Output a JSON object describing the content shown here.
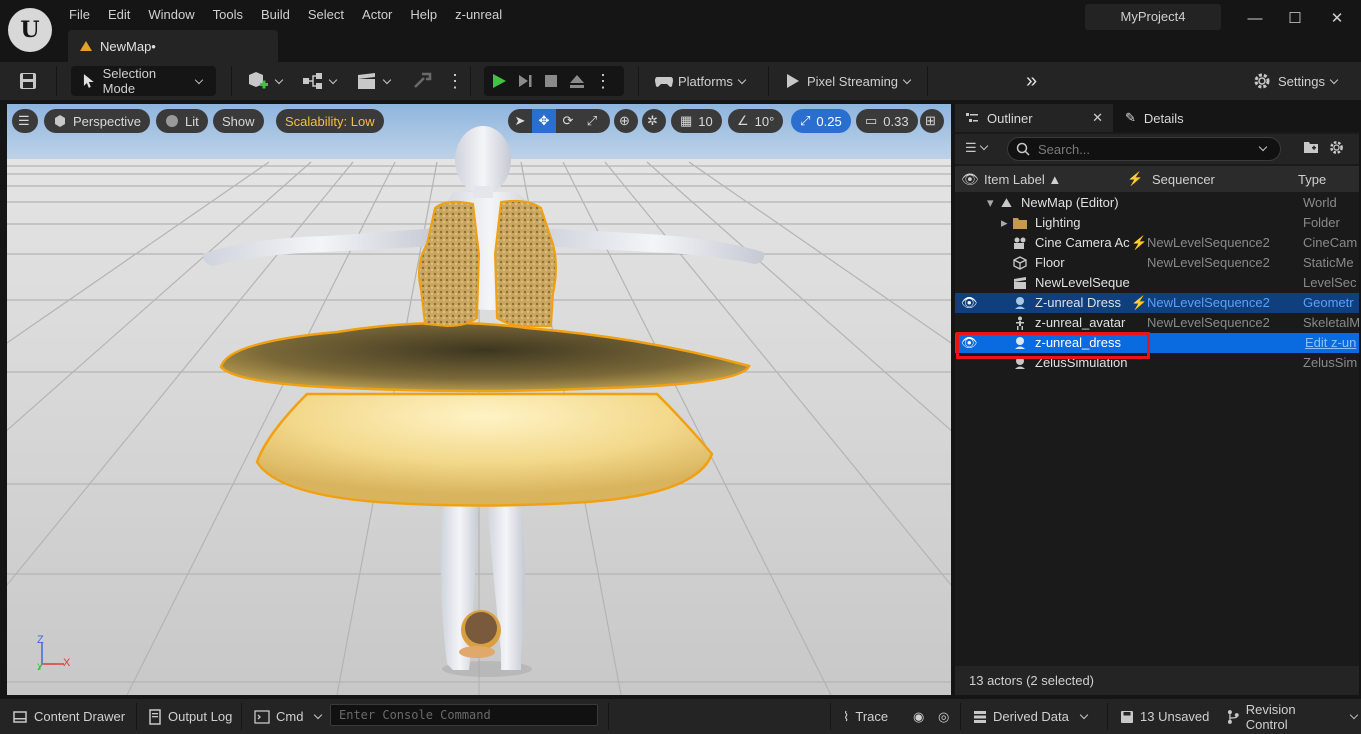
{
  "app": {
    "menu": [
      "File",
      "Edit",
      "Window",
      "Tools",
      "Build",
      "Select",
      "Actor",
      "Help",
      "z-unreal"
    ],
    "project_name": "MyProject4",
    "document_tab": "NewMap•"
  },
  "toolbar": {
    "mode_label": "Selection Mode",
    "platforms_label": "Platforms",
    "pixel_streaming_label": "Pixel Streaming",
    "settings_label": "Settings"
  },
  "viewport": {
    "perspective_label": "Perspective",
    "lit_label": "Lit",
    "show_label": "Show",
    "scalability_label": "Scalability: Low",
    "grid_snap": "10",
    "rotation_snap": "10°",
    "scale_snap": "0.25",
    "camera_speed": "0.33",
    "axis_z": "Z",
    "axis_x": "X",
    "axis_y": "Y"
  },
  "outliner": {
    "tab_outliner": "Outliner",
    "tab_details": "Details",
    "search_placeholder": "Search...",
    "columns": {
      "label": "Item Label ▲",
      "sequencer": "Sequencer",
      "type": "Type"
    },
    "rows": [
      {
        "label": "NewMap (Editor)",
        "sequencer": "",
        "type": "World",
        "icon": "map-icon"
      },
      {
        "label": "Lighting",
        "sequencer": "",
        "type": "Folder",
        "icon": "folder-icon"
      },
      {
        "label": "Cine Camera Ac",
        "sequencer": "NewLevelSequence2",
        "type": "CineCam",
        "icon": "camera-icon"
      },
      {
        "label": "Floor",
        "sequencer": "NewLevelSequence2",
        "type": "StaticMe",
        "icon": "mesh-icon"
      },
      {
        "label": "NewLevelSeque",
        "sequencer": "",
        "type": "LevelSec",
        "icon": "sequence-icon"
      },
      {
        "label": "Z-unreal Dress",
        "sequencer": "NewLevelSequence2",
        "type": "Geometr",
        "icon": "cloth-icon"
      },
      {
        "label": "z-unreal_avatar",
        "sequencer": "NewLevelSequence2",
        "type": "SkeletalM",
        "icon": "skeleton-icon"
      },
      {
        "label": "z-unreal_dress",
        "sequencer": "",
        "type": "Edit z-un",
        "icon": "cloth-icon"
      },
      {
        "label": "ZelusSimulation",
        "sequencer": "",
        "type": "ZelusSim",
        "icon": "sim-icon"
      }
    ],
    "footer": "13 actors (2 selected)"
  },
  "statusbar": {
    "content_drawer": "Content Drawer",
    "output_log": "Output Log",
    "cmd": "Cmd",
    "console_placeholder": "Enter Console Command",
    "trace": "Trace",
    "derived_data": "Derived Data",
    "unsaved": "13 Unsaved",
    "revision_control": "Revision Control"
  },
  "colors": {
    "selection_primary": "#0a6ae0",
    "selection_secondary": "#103f7e",
    "scalability_text": "#f2c13c",
    "highlight_box": "#e8141c",
    "dress_outline": "#f0a010"
  }
}
